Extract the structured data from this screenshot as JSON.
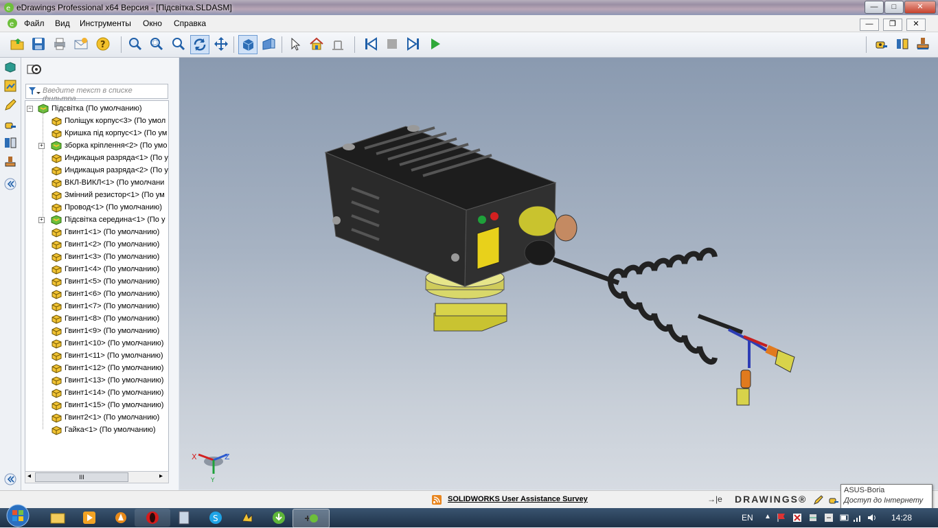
{
  "window": {
    "title": "eDrawings Professional x64 Версия - [Підсвітка.SLDASM]",
    "min": "—",
    "max": "□",
    "close": "✕"
  },
  "menu": {
    "items": [
      "Файл",
      "Вид",
      "Инструменты",
      "Окно",
      "Справка"
    ],
    "mdi_min": "—",
    "mdi_restore": "❐",
    "mdi_close": "✕"
  },
  "filter": {
    "placeholder": "Введите текст в списке фильтра"
  },
  "tree": {
    "root": "Підсвітка (По умолчанию)",
    "items": [
      "Поліщук корпус<3> (По умол",
      "Кришка під корпус<1> (По ум",
      "зборка кріплення<2> (По умо",
      "Индикацыя разряда<1> (По у",
      "Индикацыя разряда<2> (По у",
      "ВКЛ-ВИКЛ<1> (По умолчани",
      "Змінний резистор<1> (По ум",
      "Провод<1> (По умолчанию)",
      "Підсвітка середина<1> (По у",
      "Гвинт1<1> (По умолчанию)",
      "Гвинт1<2> (По умолчанию)",
      "Гвинт1<3> (По умолчанию)",
      "Гвинт1<4> (По умолчанию)",
      "Гвинт1<5> (По умолчанию)",
      "Гвинт1<6> (По умолчанию)",
      "Гвинт1<7> (По умолчанию)",
      "Гвинт1<8> (По умолчанию)",
      "Гвинт1<9> (По умолчанию)",
      "Гвинт1<10> (По умолчанию)",
      "Гвинт1<11> (По умолчанию)",
      "Гвинт1<12> (По умолчанию)",
      "Гвинт1<13> (По умолчанию)",
      "Гвинт1<14> (По умолчанию)",
      "Гвинт1<15> (По умолчанию)",
      "Гвинт2<1> (По умолчанию)",
      "Гайка<1> (По умолчанию)"
    ],
    "expandable": [
      2,
      8
    ]
  },
  "hscroll": {
    "thumb": "III",
    "left": "◂",
    "right": "▸"
  },
  "triad": {
    "x": "X",
    "y": "Y",
    "z": "Z"
  },
  "status": {
    "survey": "SOLIDWORKS User Assistance Survey",
    "logo_prefix": "→|e",
    "logo": "DRAWINGS®"
  },
  "tooltip": {
    "line1": "ASUS-Boria",
    "line2": "Доступ до Інтернету"
  },
  "taskbar": {
    "lang": "EN",
    "time": "14:28"
  },
  "colors": {
    "accent": "#1f5fa8",
    "viewport_top": "#8a9ab0",
    "viewport_bottom": "#d6dbe2"
  }
}
